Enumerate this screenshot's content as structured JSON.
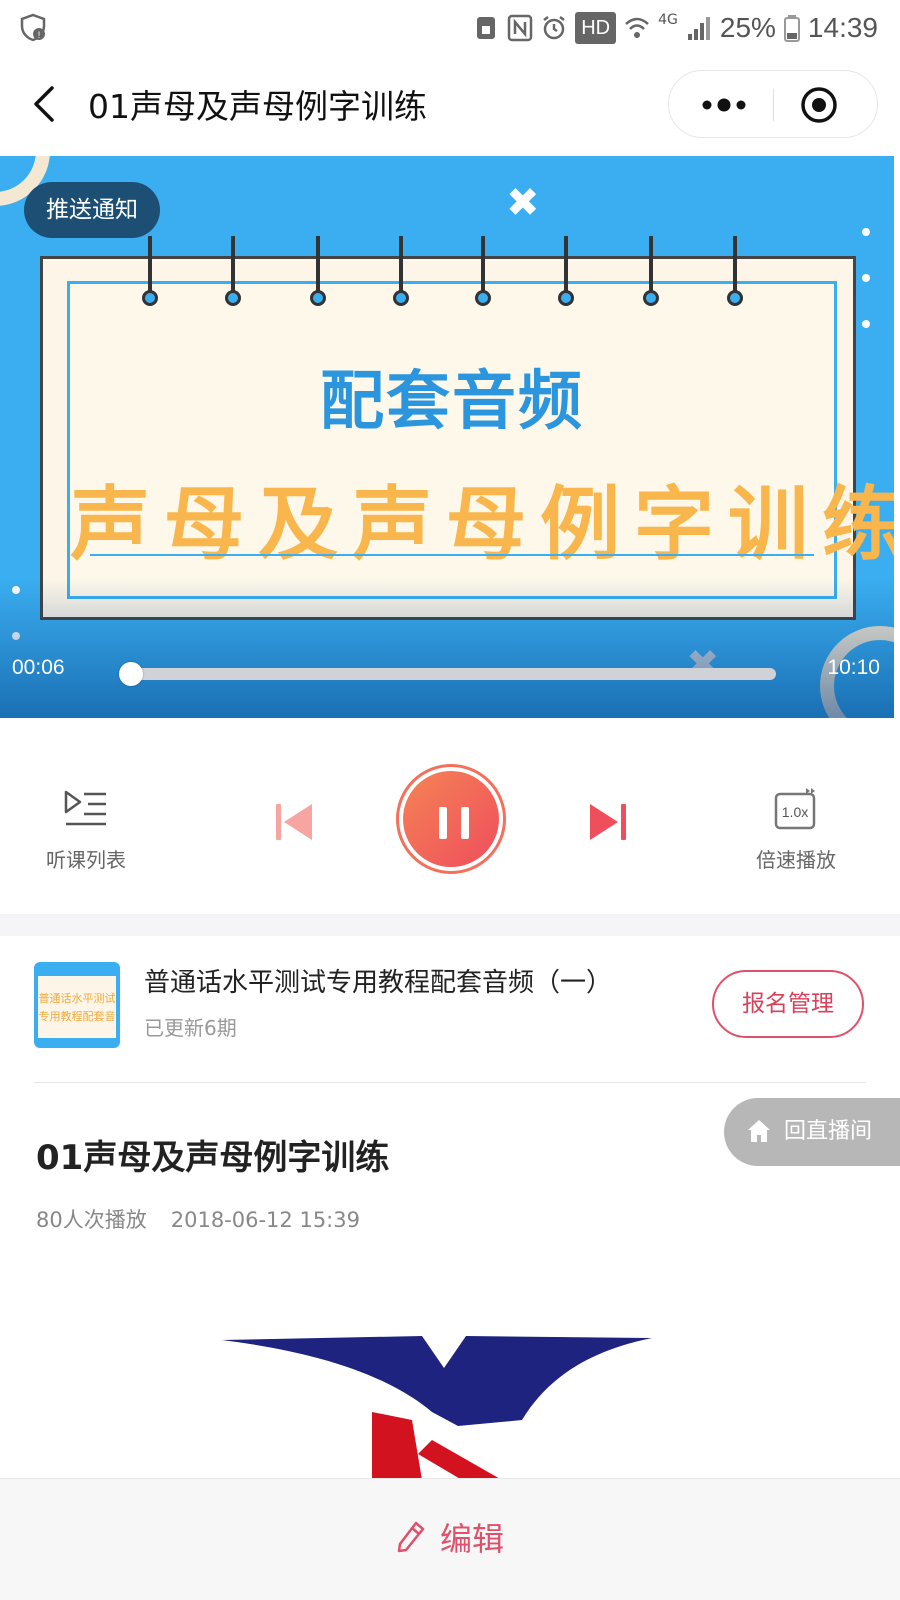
{
  "status_bar": {
    "hd": "HD",
    "network": "4G",
    "battery": "25%",
    "time": "14:39"
  },
  "title_bar": {
    "title": "01声母及声母例字训练"
  },
  "cover": {
    "push_label": "推送通知",
    "subtitle": "配套音频",
    "main_text": "声母及声母例字训练"
  },
  "player": {
    "current_time": "00:06",
    "total_time": "10:10",
    "progress": 0.01,
    "playlist_label": "听课列表",
    "speed_label": "倍速播放",
    "speed_value": "1.0x"
  },
  "course": {
    "title": "普通话水平测试专用教程配套音频（一）",
    "updated": "已更新6期",
    "signup_label": "报名管理",
    "thumb_lines": [
      "普通话水平测试",
      "专用教程配套音"
    ]
  },
  "live_button": {
    "label": "回直播间"
  },
  "lesson": {
    "title": "01声母及声母例字训练",
    "plays": "80人次播放",
    "date": "2018-06-12 15:39"
  },
  "bottom": {
    "edit_label": "编辑"
  },
  "colors": {
    "accent": "#e0506a",
    "cover_blue": "#3aaef0",
    "play_gradient_start": "#f58355",
    "play_gradient_end": "#ef4e5c",
    "cover_text_orange": "#f8b64d"
  },
  "icons": {
    "status_left": "shield-check-icon",
    "back": "back-arrow-icon",
    "more": "more-dots-icon",
    "close": "target-close-icon",
    "playlist": "playlist-icon",
    "prev": "skip-previous-icon",
    "pause": "pause-icon",
    "next": "skip-next-icon",
    "speed": "speed-icon",
    "home": "home-icon",
    "edit": "pencil-icon"
  }
}
